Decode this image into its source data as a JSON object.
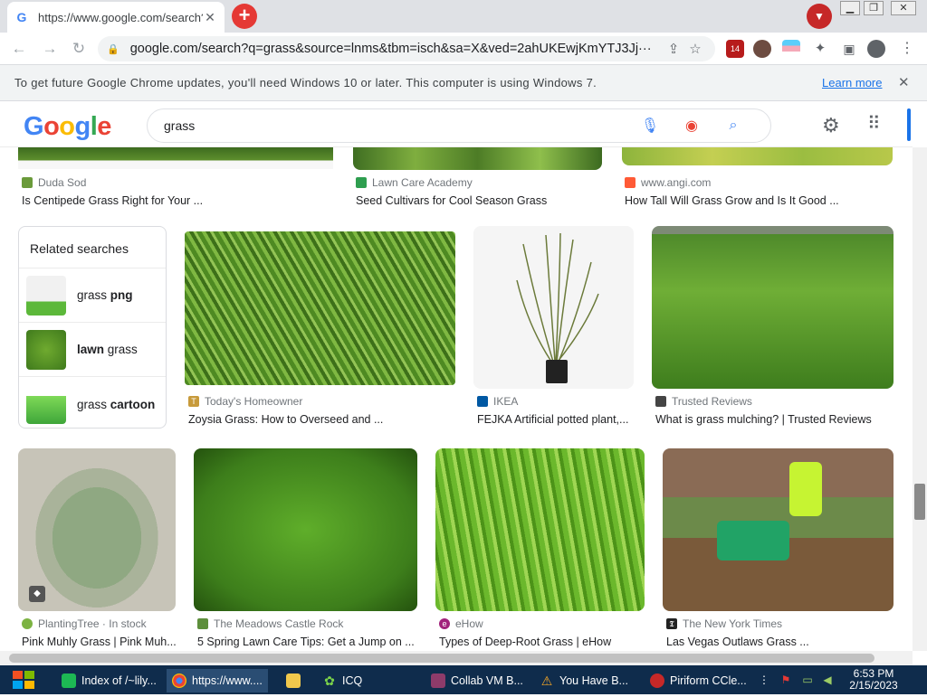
{
  "browser": {
    "tab_title": "https://www.google.com/search?q=grass",
    "tab_close": "✕",
    "new_tab": "+",
    "url": "google.com/search?q=grass&source=lnms&tbm=isch&sa=X&ved=2ahUKEwjKmYTJ3Jj···",
    "ext_badge": "14"
  },
  "infobar": {
    "message": "To get future Google Chrome updates, you'll need Windows 10 or later. This computer is using Windows 7.",
    "link": "Learn more",
    "close": "✕"
  },
  "google": {
    "logo": [
      "G",
      "o",
      "o",
      "g",
      "l",
      "e"
    ],
    "query": "grass"
  },
  "top_row": [
    {
      "source": "Duda Sod",
      "caption": "Is Centipede Grass Right for Your ..."
    },
    {
      "source": "Lawn Care Academy",
      "caption": "Seed Cultivars for Cool Season Grass"
    },
    {
      "source": "www.angi.com",
      "caption": "How Tall Will Grass Grow and Is It Good ..."
    }
  ],
  "related": {
    "header": "Related searches",
    "items": [
      {
        "plain": "grass ",
        "bold": "png",
        "bold_first": false
      },
      {
        "plain": " grass",
        "bold": "lawn",
        "bold_first": true
      },
      {
        "plain": "grass ",
        "bold": "cartoon",
        "bold_first": false
      }
    ]
  },
  "row2": [
    {
      "source": "Today's Homeowner",
      "caption": "Zoysia Grass: How to Overseed and ..."
    },
    {
      "source": "IKEA",
      "caption": "FEJKA Artificial potted plant,..."
    },
    {
      "source": "Trusted Reviews",
      "caption": "What is grass mulching? | Trusted Reviews"
    }
  ],
  "row3": [
    {
      "source": "PlantingTree · In stock",
      "caption": "Pink Muhly Grass | Pink Muh..."
    },
    {
      "source": "The Meadows Castle Rock",
      "caption": "5 Spring Lawn Care Tips: Get a Jump on ..."
    },
    {
      "source": "eHow",
      "caption": "Types of Deep-Root Grass | eHow"
    },
    {
      "source": "The New York Times",
      "caption": "Las Vegas Outlaws Grass ..."
    }
  ],
  "taskbar": {
    "items": [
      "Index of /~lily...",
      "https://www....",
      "",
      "ICQ",
      "Collab VM B...",
      "You Have B...",
      "Piriform CCle..."
    ],
    "time": "6:53 PM",
    "date": "2/15/2023"
  }
}
